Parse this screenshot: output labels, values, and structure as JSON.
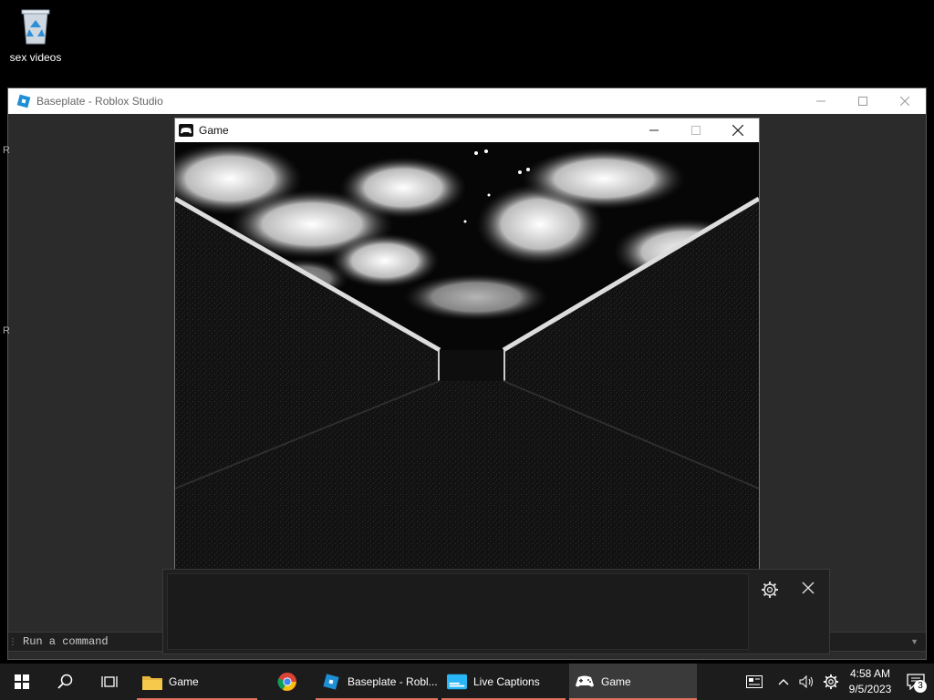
{
  "desktop": {
    "recycle_bin_label": "sex videos"
  },
  "studio": {
    "title": "Baseplate - Roblox Studio",
    "side_marker_top": "R",
    "side_marker_mid": "R",
    "command_placeholder": "Run a command"
  },
  "game_window": {
    "title": "Game",
    "scene": {
      "sky_color": "#0a0a0a",
      "cloud_color": "#e8e8e8",
      "wall_color": "#1a1a1a",
      "floor_color": "#141414"
    }
  },
  "live_captions": {
    "text": ""
  },
  "taskbar": {
    "apps": [
      {
        "label": "Game",
        "icon": "folder-icon"
      },
      {
        "label": "",
        "icon": "chrome-icon"
      },
      {
        "label": "Baseplate - Robl...",
        "icon": "roblox-studio-icon"
      },
      {
        "label": "Live Captions",
        "icon": "live-captions-icon"
      },
      {
        "label": "Game",
        "icon": "game-controller-icon"
      }
    ],
    "clock_time": "4:58 AM",
    "clock_date": "9/5/2023",
    "notification_count": "3"
  },
  "colors": {
    "taskbar_underline": "#e0715d",
    "roblox_blue": "#1e8fd6"
  }
}
